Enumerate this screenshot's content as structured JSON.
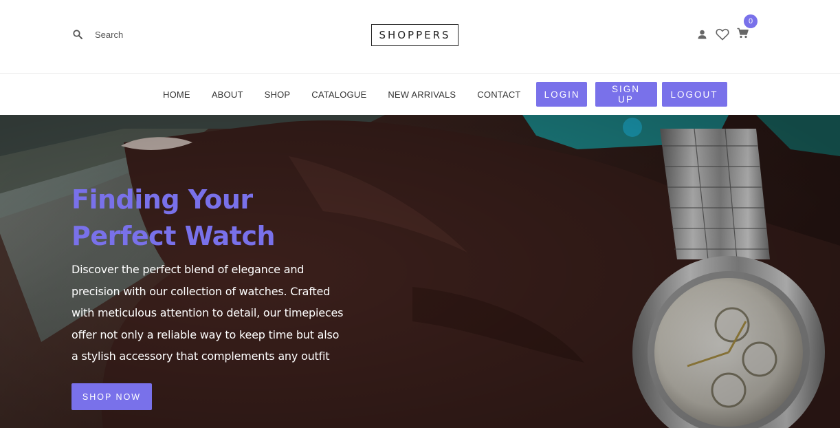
{
  "header": {
    "search": {
      "placeholder": "Search",
      "icon": "search-icon"
    },
    "logo": "SHOPPERS",
    "icons": {
      "user": "person-icon",
      "wishlist": "heart-icon",
      "cart": "cart-icon"
    },
    "cart_count": "0"
  },
  "nav": {
    "links": [
      {
        "label": "HOME"
      },
      {
        "label": "ABOUT"
      },
      {
        "label": "SHOP"
      },
      {
        "label": "CATALOGUE"
      },
      {
        "label": "NEW ARRIVALS"
      },
      {
        "label": "CONTACT"
      }
    ],
    "buttons": [
      {
        "label": "LOGIN"
      },
      {
        "label": "SIGN UP"
      },
      {
        "label": "LOGOUT"
      }
    ]
  },
  "hero": {
    "title_line1": "Finding Your",
    "title_line2": "Perfect Watch",
    "description": "Discover the perfect blend of elegance and precision with our collection of watches. Crafted with meticulous attention to detail, our timepieces offer not only a reliable way to keep time but also a stylish accessory that complements any outfit",
    "cta_label": "SHOP NOW",
    "image": "wrist-watch-photo"
  },
  "colors": {
    "accent": "#7971ea",
    "text_dark": "#333333",
    "hero_text": "#ffffff"
  }
}
